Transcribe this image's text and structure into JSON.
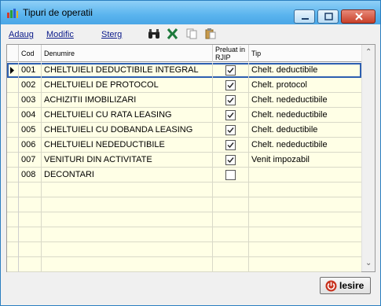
{
  "window": {
    "title": "Tipuri de operatii"
  },
  "menu": {
    "adaug": "Adaug",
    "modific": "Modific",
    "sterg": "Sterg"
  },
  "toolbar_icons": [
    "binoculars-icon",
    "excel-icon",
    "copy-icon",
    "paste-icon"
  ],
  "grid": {
    "columns": {
      "cod": "Cod",
      "denumire": "Denumire",
      "preluat_line1": "Preluat in",
      "preluat_line2": "RJIP",
      "tip": "Tip"
    },
    "rows": [
      {
        "cod": "001",
        "denumire": "CHELTUIELI DEDUCTIBILE INTEGRAL",
        "preluat": true,
        "tip": "Chelt. deductibile"
      },
      {
        "cod": "002",
        "denumire": "CHELTUIELI DE PROTOCOL",
        "preluat": true,
        "tip": "Chelt. protocol"
      },
      {
        "cod": "003",
        "denumire": "ACHIZITII IMOBILIZARI",
        "preluat": true,
        "tip": "Chelt. nedeductibile"
      },
      {
        "cod": "004",
        "denumire": "CHELTUIELI CU RATA LEASING",
        "preluat": true,
        "tip": "Chelt. nedeductibile"
      },
      {
        "cod": "005",
        "denumire": "CHELTUIELI CU DOBANDA LEASING",
        "preluat": true,
        "tip": "Chelt. deductibile"
      },
      {
        "cod": "006",
        "denumire": "CHELTUIELI NEDEDUCTIBILE",
        "preluat": true,
        "tip": "Chelt. nedeductibile"
      },
      {
        "cod": "007",
        "denumire": "VENITURI DIN ACTIVITATE",
        "preluat": true,
        "tip": "Venit impozabil"
      },
      {
        "cod": "008",
        "denumire": "DECONTARI",
        "preluat": false,
        "tip": ""
      }
    ],
    "empty_rows": 6
  },
  "footer": {
    "exit_label": "Iesire"
  },
  "colors": {
    "row_bg": "#ffffe6",
    "selection_border": "#2d5fb0",
    "title_gradient": "#5ab4ee"
  }
}
